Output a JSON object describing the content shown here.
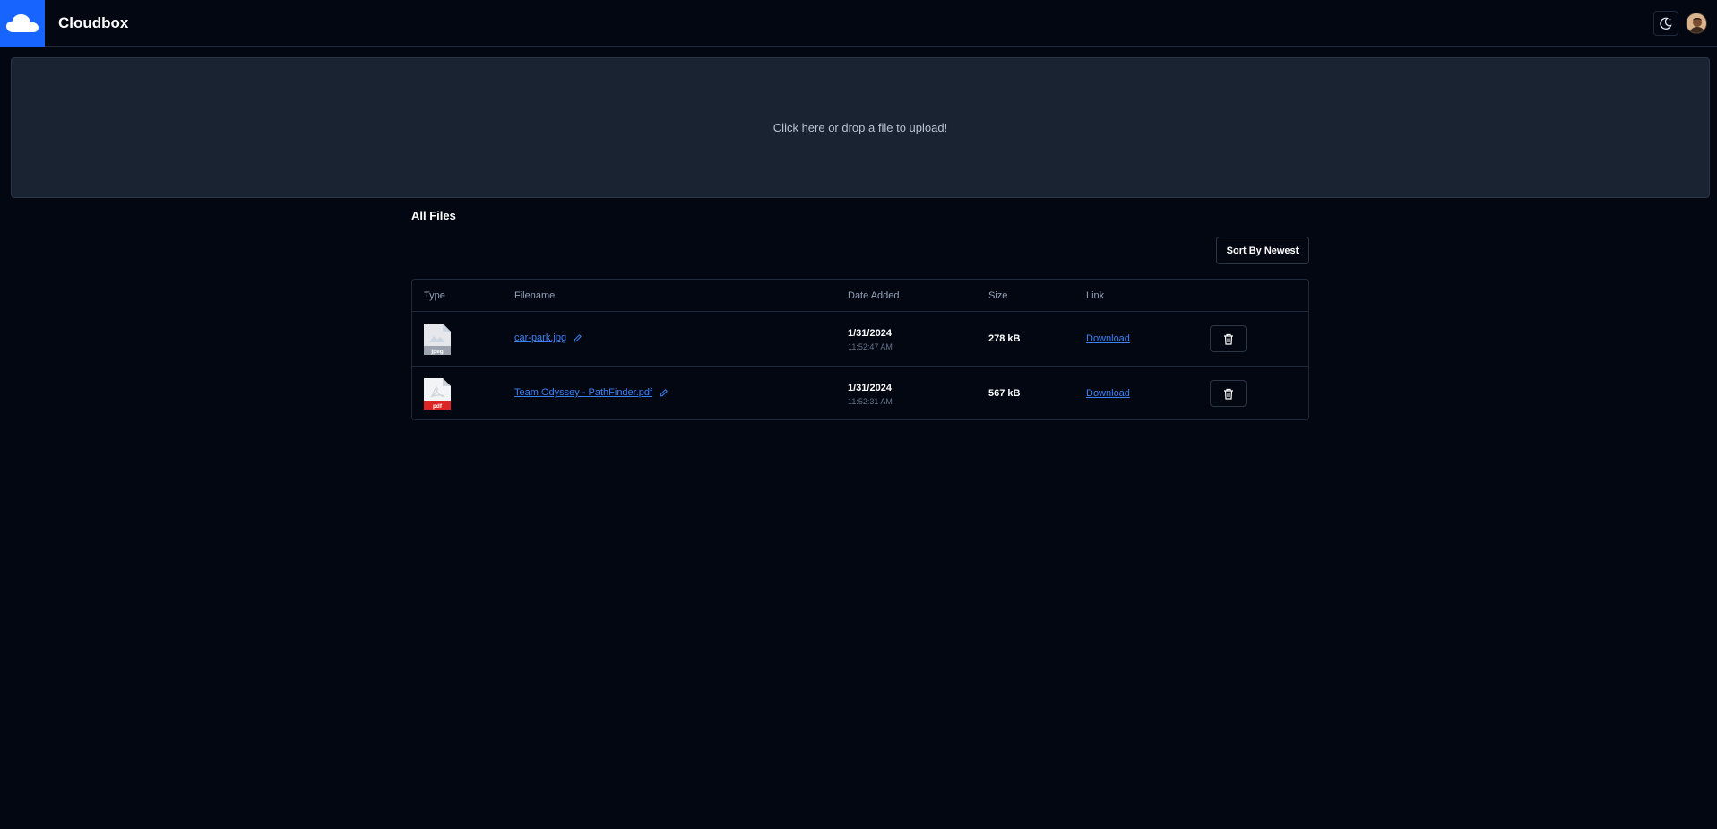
{
  "header": {
    "app_title": "Cloudbox",
    "brand_color": "#1764ff",
    "logo_icon": "cloud-icon",
    "theme_toggle_icon": "theme-toggle-icon",
    "avatar_icon": "user-avatar"
  },
  "upload": {
    "prompt": "Click here or drop a file to upload!"
  },
  "files_section": {
    "title": "All Files",
    "sort_label": "Sort By Newest",
    "columns": {
      "type": "Type",
      "filename": "Filename",
      "date_added": "Date Added",
      "size": "Size",
      "link": "Link"
    },
    "rows": [
      {
        "type_label": "jpeg",
        "filename": "car-park.jpg",
        "date": "1/31/2024",
        "time": "11:52:47 AM",
        "size": "278 kB",
        "link_label": "Download"
      },
      {
        "type_label": "pdf",
        "filename": "Team Odyssey - PathFinder.pdf",
        "date": "1/31/2024",
        "time": "11:52:31 AM",
        "size": "567 kB",
        "link_label": "Download"
      }
    ]
  },
  "colors": {
    "background": "#030712",
    "link": "#3b82f6",
    "pdf_badge": "#dc2626",
    "jpeg_badge": "#9ca3af"
  }
}
